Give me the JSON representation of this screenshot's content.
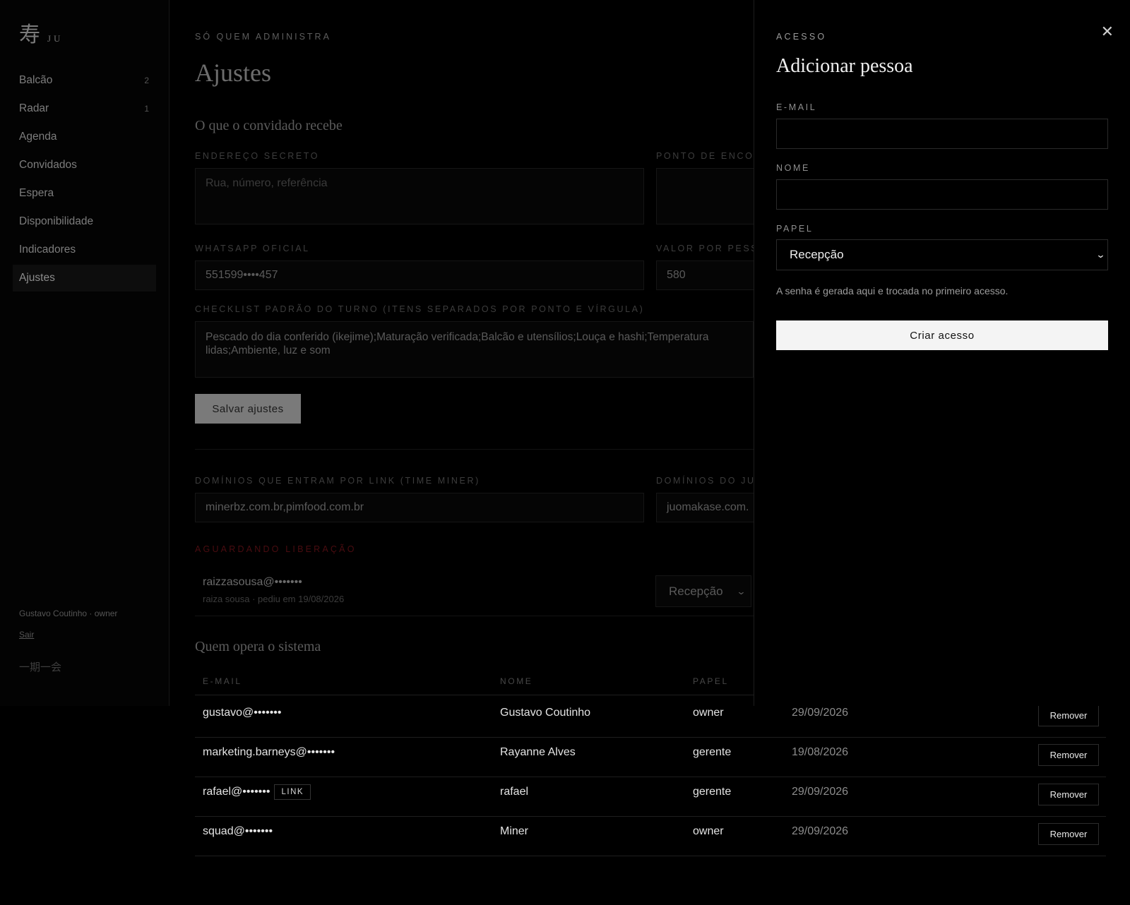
{
  "sidebar": {
    "logo_kanji": "寿",
    "logo_text": "JU",
    "items": [
      {
        "label": "Balcão",
        "count": "2"
      },
      {
        "label": "Radar",
        "count": "1"
      },
      {
        "label": "Agenda",
        "count": ""
      },
      {
        "label": "Convidados",
        "count": ""
      },
      {
        "label": "Espera",
        "count": ""
      },
      {
        "label": "Disponibilidade",
        "count": ""
      },
      {
        "label": "Indicadores",
        "count": ""
      },
      {
        "label": "Ajustes",
        "count": "",
        "active": true
      }
    ],
    "user": "Gustavo Coutinho · owner",
    "logout": "Sair",
    "motto": "一期一会"
  },
  "main": {
    "eyebrow": "Só quem administra",
    "title": "Ajustes",
    "guest_section": "O que o convidado recebe",
    "fields": {
      "address_label": "Endereço secreto",
      "address_placeholder": "Rua, número, referência",
      "meeting_label": "Ponto de encon",
      "whatsapp_label": "WhatsApp oficial",
      "whatsapp_value": "551599••••457",
      "price_label": "Valor por pesso",
      "price_value": "580",
      "checklist_label": "Checklist padrão do turno (itens separados por ponto e vírgula)",
      "checklist_value": "Pescado do dia conferido (ikejime);Maturação verificada;Balcão e utensílios;Louça e hashi;Temperatura lidas;Ambiente, luz e som",
      "save_button": "Salvar ajustes",
      "domains_link_label": "Domínios que entram por link (time Miner)",
      "domains_link_value": "minerbz.com.br,pimfood.com.br",
      "domains_ju_label": "Domínios do Ju",
      "domains_ju_value": "juomakase.com."
    },
    "pending": {
      "title": "Aguardando liberação",
      "email": "raizzasousa@•••••••",
      "sub": "raiza sousa · pediu em 19/08/2026",
      "role": "Recepção"
    },
    "operators": {
      "title": "Quem opera o sistema",
      "headers": [
        "E-mail",
        "Nome",
        "Papel"
      ],
      "rows": [
        {
          "email": "gustavo@•••••••",
          "badge": "",
          "name": "Gustavo Coutinho",
          "role": "owner",
          "date": "29/09/2026",
          "action": "Remover"
        },
        {
          "email": "marketing.barneys@•••••••",
          "badge": "",
          "name": "Rayanne Alves",
          "role": "gerente",
          "date": "19/08/2026",
          "action": "Remover"
        },
        {
          "email": "rafael@•••••••",
          "badge": "LINK",
          "name": "rafael",
          "role": "gerente",
          "date": "29/09/2026",
          "action": "Remover"
        },
        {
          "email": "squad@•••••••",
          "badge": "",
          "name": "Miner",
          "role": "owner",
          "date": "29/09/2026",
          "action": "Remover"
        }
      ]
    }
  },
  "panel": {
    "eyebrow": "Acesso",
    "title": "Adicionar pessoa",
    "email_label": "E-mail",
    "name_label": "Nome",
    "role_label": "Papel",
    "role_value": "Recepção",
    "hint": "A senha é gerada aqui e trocada no primeiro acesso.",
    "create_button": "Criar acesso",
    "close_icon": "close-icon"
  },
  "colors": {
    "background": "#000000",
    "accent_red": "#4a0c10",
    "primary_button": "#f4f4f4"
  }
}
